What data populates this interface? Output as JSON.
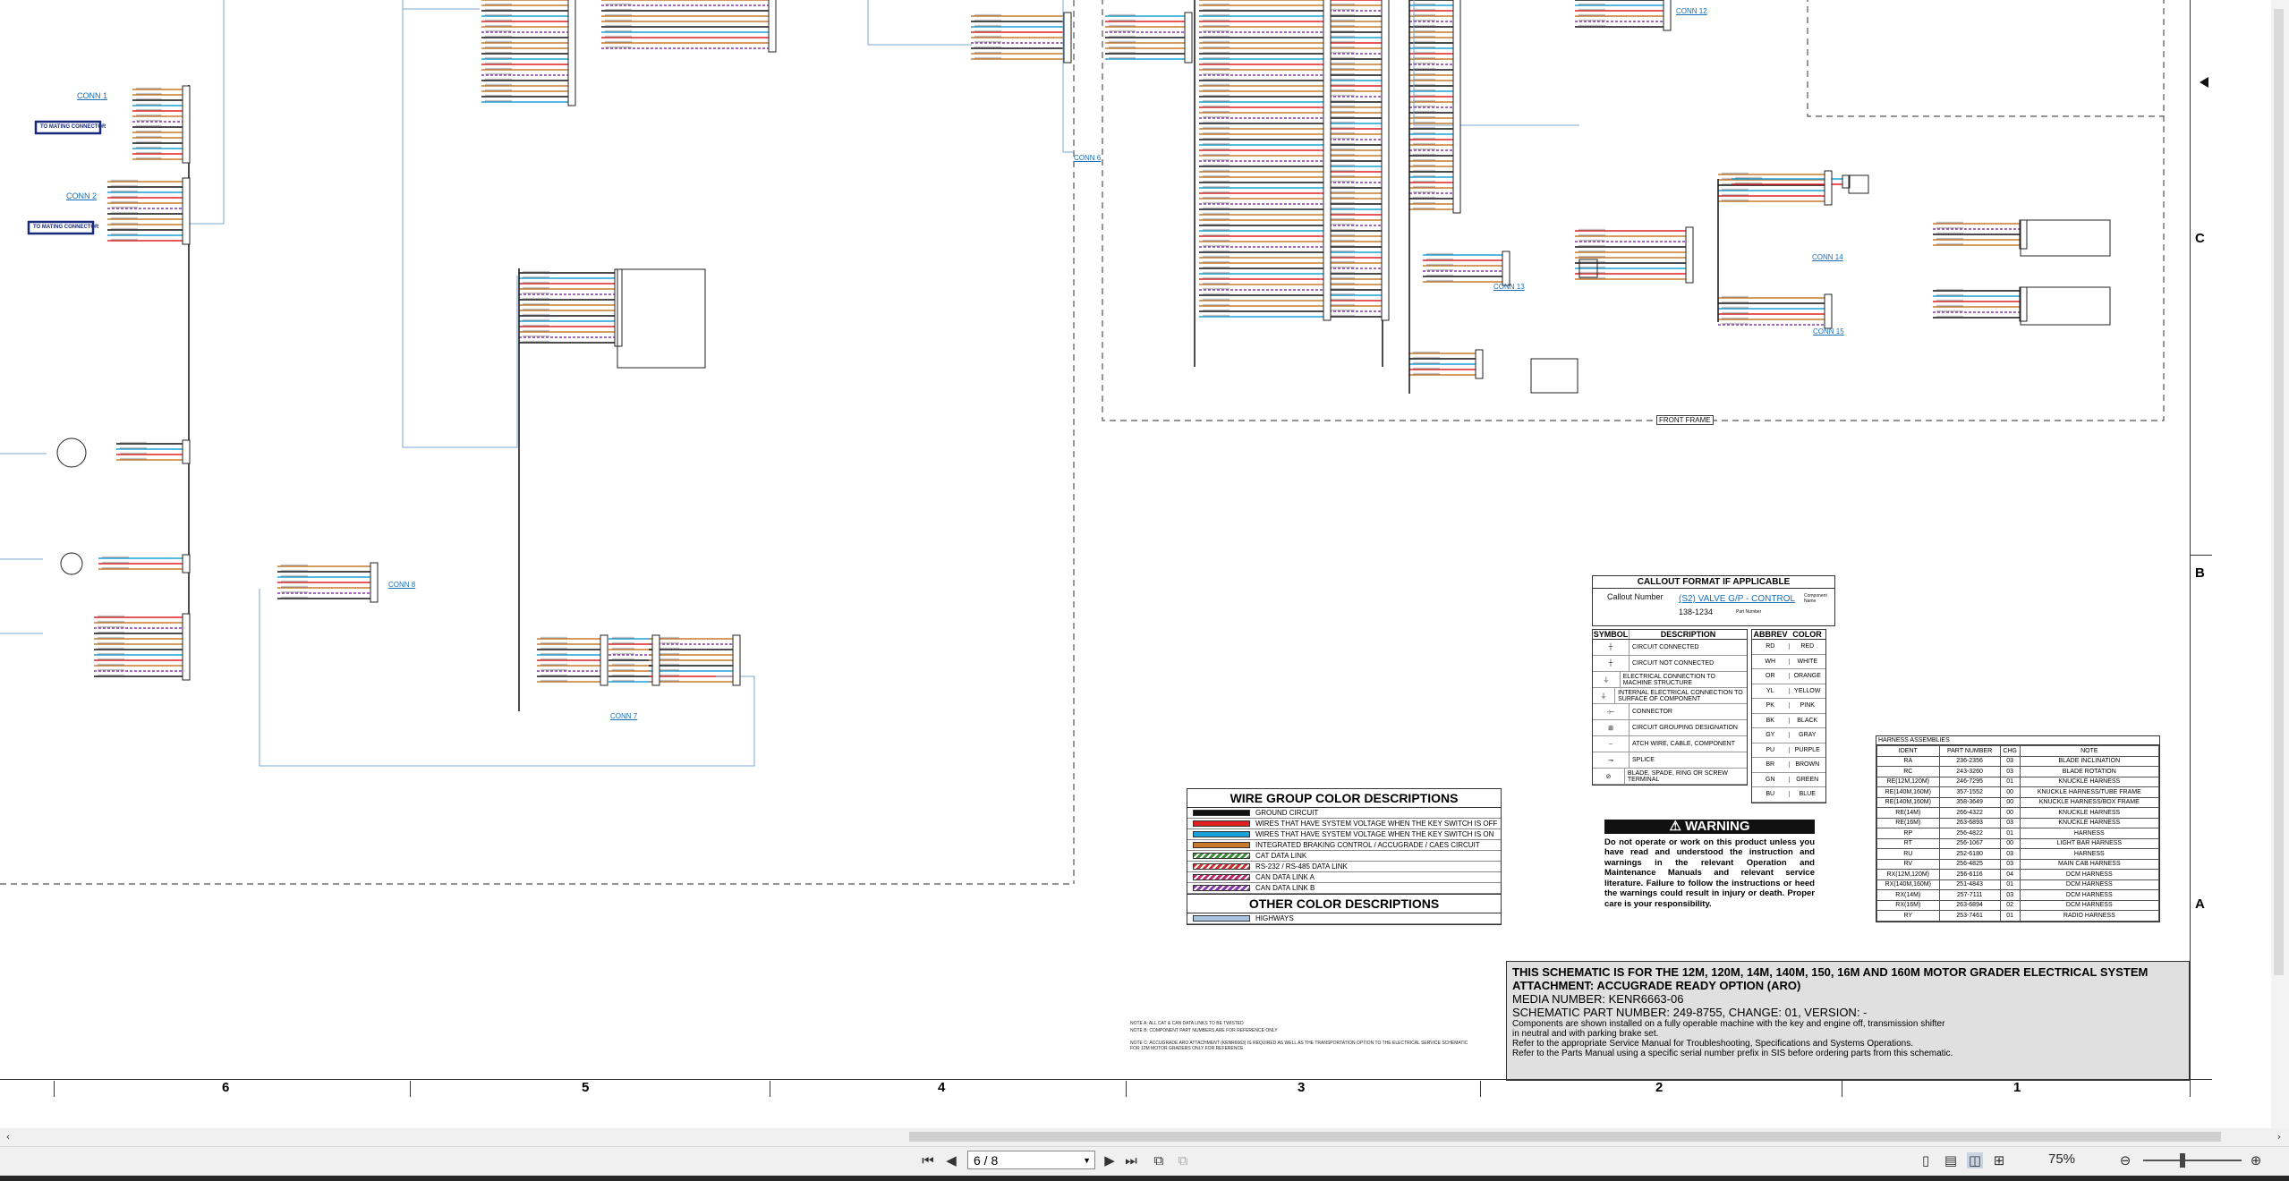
{
  "connectors": {
    "conn1": "CONN 1",
    "conn2": "CONN 2",
    "conn6": "CONN 6",
    "conn7": "CONN 7",
    "conn8": "CONN 8",
    "conn12": "CONN 12",
    "conn13": "CONN 13",
    "conn14": "CONN 14",
    "conn15": "CONN 15",
    "mating1": "TO MATING CONNECTOR",
    "mating2": "TO MATING CONNECTOR",
    "front_frame": "FRONT FRAME"
  },
  "wire_group": {
    "title": "WIRE GROUP COLOR DESCRIPTIONS",
    "rows": [
      {
        "label": "GROUND CIRCUIT",
        "color": "#111111"
      },
      {
        "label": "WIRES THAT HAVE SYSTEM VOLTAGE WHEN THE KEY SWITCH IS OFF",
        "color": "#e02020"
      },
      {
        "label": "WIRES THAT HAVE SYSTEM VOLTAGE WHEN THE KEY SWITCH IS ON",
        "color": "#1aa0d8"
      },
      {
        "label": "INTEGRATED BRAKING CONTROL / ACCUGRADE / CAES CIRCUIT",
        "color": "#c87a2a"
      },
      {
        "label": "CAT DATA LINK",
        "color": "#3a8a3a"
      },
      {
        "label": "RS-232 / RS-485 DATA LINK",
        "color": "#d03030"
      },
      {
        "label": "CAN DATA LINK A",
        "color": "#b82a6a"
      },
      {
        "label": "CAN DATA LINK B",
        "color": "#8a3aa8"
      }
    ],
    "other_title": "OTHER COLOR DESCRIPTIONS",
    "other_rows": [
      {
        "label": "HIGHWAYS",
        "color": "#a8c4e0"
      }
    ]
  },
  "callout": {
    "title": "CALLOUT FORMAT IF APPLICABLE",
    "callout_number": "Callout Number",
    "component_name": "(S2) VALVE G/P - CONTROL",
    "component_label": "Component Name",
    "part_number": "138-1234",
    "part_label": "Part Number"
  },
  "symbols": {
    "h1": "SYMBOL",
    "h2": "DESCRIPTION",
    "rows": [
      "CIRCUIT CONNECTED",
      "CIRCUIT NOT CONNECTED",
      "ELECTRICAL CONNECTION TO MACHINE STRUCTURE",
      "INTERNAL ELECTRICAL CONNECTION TO SURFACE OF COMPONENT",
      "CONNECTOR",
      "CIRCUIT GROUPING DESIGNATION",
      "ATCH WIRE, CABLE, COMPONENT",
      "SPLICE",
      "BLADE, SPADE, RING OR SCREW TERMINAL"
    ]
  },
  "abbrev": {
    "h1": "ABBREV",
    "h2": "COLOR",
    "rows": [
      [
        "RD",
        "RED"
      ],
      [
        "WH",
        "WHITE"
      ],
      [
        "OR",
        "ORANGE"
      ],
      [
        "YL",
        "YELLOW"
      ],
      [
        "PK",
        "PINK"
      ],
      [
        "BK",
        "BLACK"
      ],
      [
        "GY",
        "GRAY"
      ],
      [
        "PU",
        "PURPLE"
      ],
      [
        "BR",
        "BROWN"
      ],
      [
        "GN",
        "GREEN"
      ],
      [
        "BU",
        "BLUE"
      ]
    ]
  },
  "warning": {
    "title": "WARNING",
    "text": "Do not operate or work on this product unless you have read and understood the instruction and warnings in the relevant Operation and Maintenance Manuals and relevant service literature. Failure to follow the instructions or heed the warnings could result in injury or death. Proper care is your responsibility."
  },
  "harness": {
    "title": "HARNESS ASSEMBLIES",
    "headers": [
      "IDENT",
      "PART NUMBER",
      "CHG",
      "NOTE"
    ],
    "rows": [
      [
        "RA",
        "236-2356",
        "03",
        "BLADE INCLINATION"
      ],
      [
        "RC",
        "243-3260",
        "03",
        "BLADE ROTATION"
      ],
      [
        "RE(12M,120M)",
        "246-7295",
        "01",
        "KNUCKLE HARNESS"
      ],
      [
        "RE(140M,160M)",
        "357-1552",
        "00",
        "KNUCKLE HARNESS/TUBE FRAME"
      ],
      [
        "RE(140M,160M)",
        "358-3649",
        "00",
        "KNUCKLE HARNESS/BOX FRAME"
      ],
      [
        "RE(14M)",
        "266-4322",
        "00",
        "KNUCKLE HARNESS"
      ],
      [
        "RE(16M)",
        "263-6893",
        "03",
        "KNUCKLE HARNESS"
      ],
      [
        "RP",
        "256-4822",
        "01",
        "HARNESS"
      ],
      [
        "RT",
        "256-1067",
        "00",
        "LIGHT BAR HARNESS"
      ],
      [
        "RU",
        "252-6180",
        "03",
        "HARNESS"
      ],
      [
        "RV",
        "256-4825",
        "03",
        "MAIN CAB HARNESS"
      ],
      [
        "RX(12M,120M)",
        "256-6116",
        "04",
        "DCM HARNESS"
      ],
      [
        "RX(140M,160M)",
        "251-4843",
        "01",
        "DCM HARNESS"
      ],
      [
        "RX(14M)",
        "257-7111",
        "03",
        "DCM HARNESS"
      ],
      [
        "RX(16M)",
        "263-6894",
        "02",
        "DCM HARNESS"
      ],
      [
        "RY",
        "253-7461",
        "01",
        "RADIO HARNESS"
      ]
    ]
  },
  "title_block": {
    "line1": "THIS SCHEMATIC IS FOR THE 12M, 120M, 14M, 140M, 150, 16M AND 160M MOTOR GRADER ELECTRICAL SYSTEM",
    "line2": "ATTACHMENT: ACCUGRADE READY OPTION (ARO)",
    "line3": "MEDIA NUMBER: KENR6663-06",
    "line4": "SCHEMATIC PART NUMBER: 249-8755, CHANGE: 01, VERSION: -",
    "s1": "Components are shown installed on a fully operable machine with the key and engine off, transmission shifter",
    "s2": "in neutral and with parking brake set.",
    "s3": "Refer to the appropriate Service Manual for Troubleshooting, Specifications and Systems Operations.",
    "s4": "Refer to the Parts Manual using a specific serial number prefix in SIS before ordering parts from this schematic."
  },
  "notes": [
    "NOTE A: ALL CAT & CAN DATA LINKS TO BE TWISTED",
    "NOTE B: COMPONENT PART NUMBERS ARE FOR REFERENCE ONLY",
    "NOTE C: ACCUGRADE ARO ATTACHMENT (KENR6663) IS REQUIRED AS WELL AS THE TRANSPORTATION OPTION TO THE ELECTRICAL SERVICE SCHEMATIC",
    "FOR 12M MOTOR GRADERS ONLY FOR REFERENCE"
  ],
  "zones": {
    "numbers": [
      "6",
      "5",
      "4",
      "3",
      "2",
      "1"
    ],
    "letters": [
      "C",
      "B",
      "A"
    ]
  },
  "viewer": {
    "page_value": "6 / 8",
    "zoom": "75%"
  }
}
